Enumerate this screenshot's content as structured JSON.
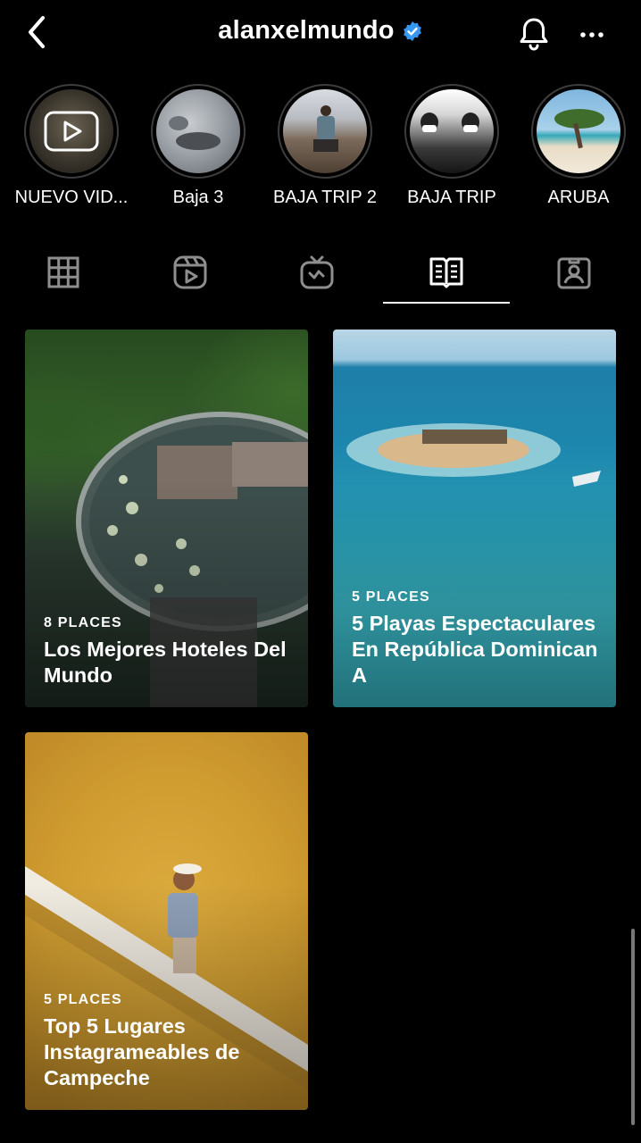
{
  "header": {
    "username": "alanxelmundo"
  },
  "highlights": [
    {
      "label": "NUEVO VID..."
    },
    {
      "label": "Baja 3"
    },
    {
      "label": "BAJA TRIP 2"
    },
    {
      "label": "BAJA TRIP"
    },
    {
      "label": "ARUBA"
    }
  ],
  "tabs": [
    {
      "name": "posts-grid",
      "icon": "grid-icon"
    },
    {
      "name": "reels",
      "icon": "reels-icon"
    },
    {
      "name": "igtv",
      "icon": "igtv-icon"
    },
    {
      "name": "guides",
      "icon": "guides-icon",
      "active": true
    },
    {
      "name": "tagged",
      "icon": "tagged-icon"
    }
  ],
  "guides": [
    {
      "places": "8 PLACES",
      "title": "Los Mejores Hoteles Del Mundo"
    },
    {
      "places": "5 PLACES",
      "title": "5 Playas Espectaculares En República Dominican A"
    },
    {
      "places": "5 PLACES",
      "title": "Top 5 Lugares Instagrameables de Campeche"
    }
  ],
  "colors": {
    "background": "#000000",
    "verified": "#3897f0",
    "ring": "#3d3d3d"
  }
}
